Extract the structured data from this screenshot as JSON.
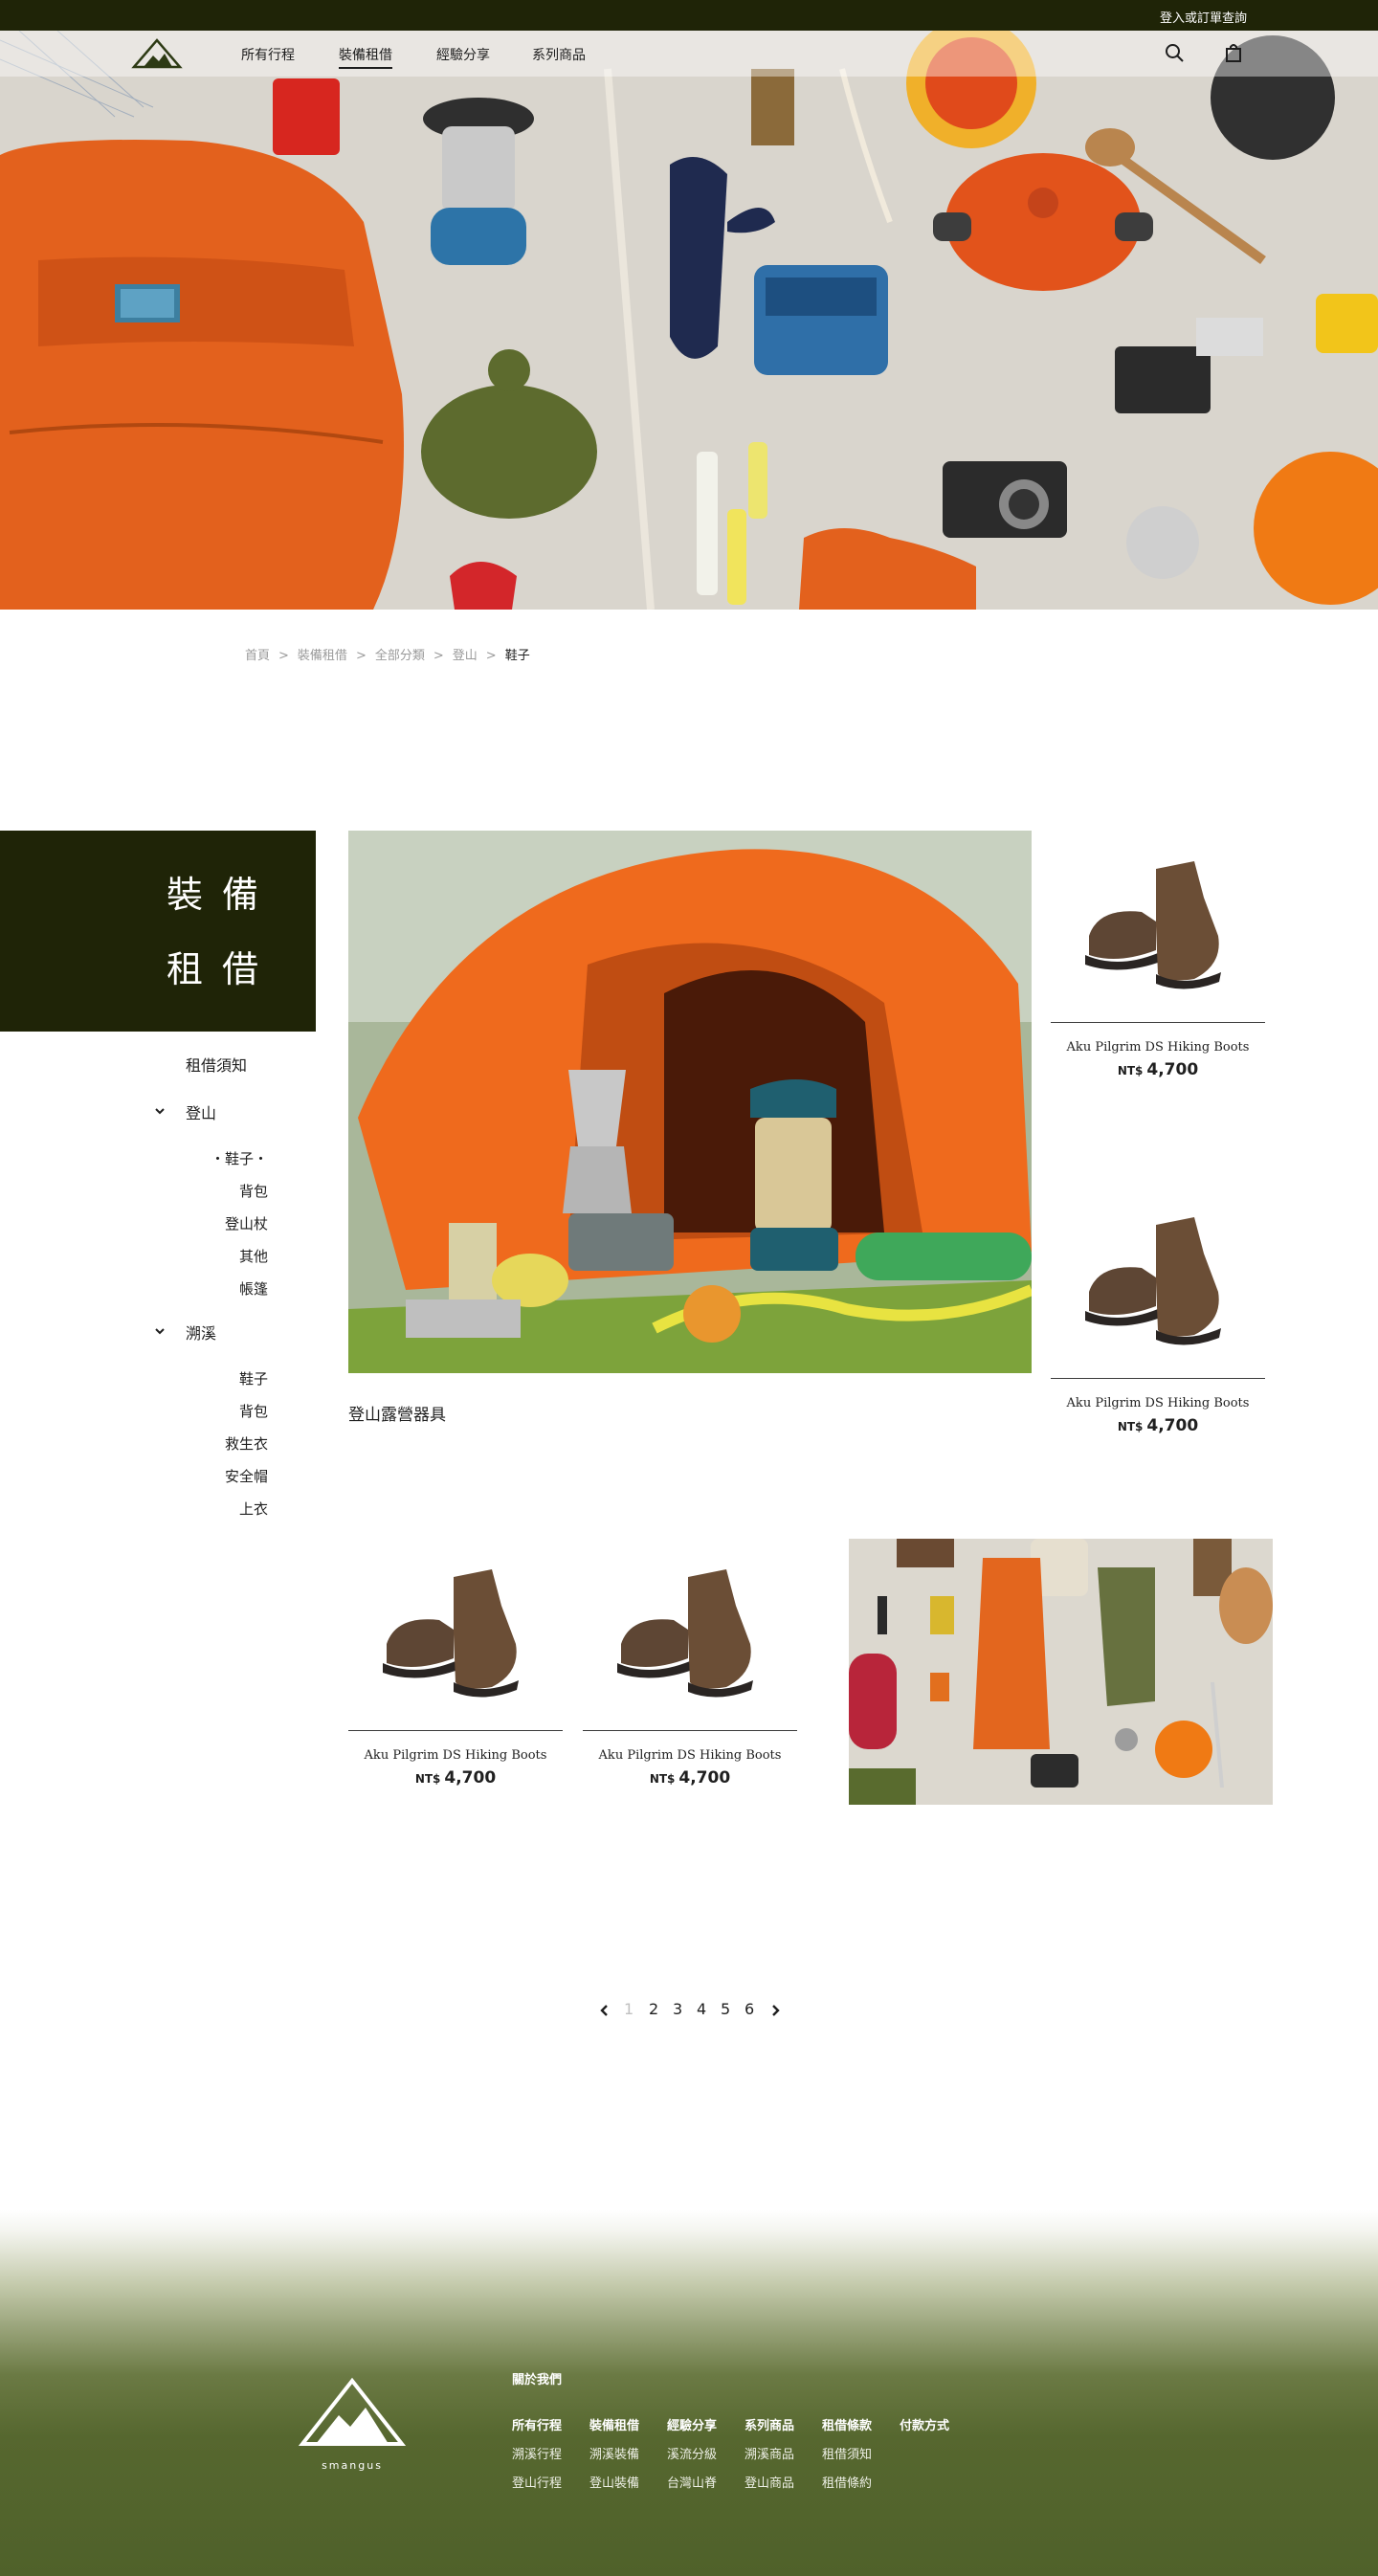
{
  "topbar": {
    "login_label": "登入或訂單查詢"
  },
  "nav": {
    "items": [
      "所有行程",
      "裝備租借",
      "經驗分享",
      "系列商品"
    ],
    "active_index": 1
  },
  "breadcrumb": [
    "首頁",
    "裝備租借",
    "全部分類",
    "登山",
    "鞋子"
  ],
  "breadcrumb_sep": ">",
  "side": {
    "title_line1": "裝備",
    "title_line2": "租借",
    "notice": "租借須知",
    "groups": [
      {
        "label": "登山",
        "items": [
          "鞋子",
          "背包",
          "登山杖",
          "其他",
          "帳篷"
        ]
      },
      {
        "label": "溯溪",
        "items": [
          "鞋子",
          "背包",
          "救生衣",
          "安全帽",
          "上衣"
        ]
      }
    ],
    "active_marker": "・",
    "active_item": "鞋子"
  },
  "feature": {
    "label": "登山露營器具"
  },
  "products": [
    {
      "name": "Aku Pilgrim DS Hiking Boots",
      "currency": "NT$",
      "price": "4,700"
    },
    {
      "name": "Aku Pilgrim DS Hiking Boots",
      "currency": "NT$",
      "price": "4,700"
    },
    {
      "name": "Aku Pilgrim DS Hiking Boots",
      "currency": "NT$",
      "price": "4,700"
    },
    {
      "name": "Aku Pilgrim DS Hiking Boots",
      "currency": "NT$",
      "price": "4,700"
    }
  ],
  "pagination": {
    "pages": [
      "1",
      "2",
      "3",
      "4",
      "5",
      "6"
    ],
    "current": "1"
  },
  "footer": {
    "brand": "smangus",
    "about": "關於我們",
    "columns": [
      {
        "head": "所有行程",
        "items": [
          "溯溪行程",
          "登山行程"
        ]
      },
      {
        "head": "裝備租借",
        "items": [
          "溯溪裝備",
          "登山裝備"
        ]
      },
      {
        "head": "經驗分享",
        "items": [
          "溪流分級",
          "台灣山脊"
        ]
      },
      {
        "head": "系列商品",
        "items": [
          "溯溪商品",
          "登山商品"
        ]
      },
      {
        "head": "租借條款",
        "items": [
          "租借須知",
          "租借條約"
        ]
      },
      {
        "head": "付款方式",
        "items": []
      }
    ]
  },
  "colors": {
    "dark_green": "#1f2407",
    "footer_green": "#56672f",
    "orange": "#e8601c"
  }
}
